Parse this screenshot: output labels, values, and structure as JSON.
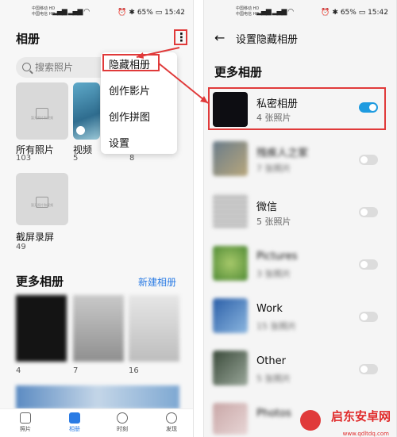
{
  "left": {
    "status": {
      "carrier_line1": "中国移动 HD",
      "carrier_line2": "中国电信 HD",
      "signal": "4G 4G",
      "battery": "65%",
      "time": "15:42"
    },
    "title": "相册",
    "search_placeholder": "搜索照片",
    "albums": [
      {
        "name": "所有照片",
        "count": "103"
      },
      {
        "name": "视频",
        "count": "5"
      },
      {
        "name": "",
        "count": "8"
      },
      {
        "name": "截屏录屏",
        "count": "49"
      }
    ],
    "thumb_caption": "暂无照片和视频",
    "menu": [
      "隐藏相册",
      "创作影片",
      "创作拼图",
      "设置"
    ],
    "more_albums_title": "更多相册",
    "new_album_link": "新建相册",
    "more_counts": [
      "4",
      "7",
      "16"
    ],
    "tabs": [
      {
        "label": "照片",
        "icon": "photo-icon"
      },
      {
        "label": "相册",
        "icon": "album-icon"
      },
      {
        "label": "时刻",
        "icon": "moment-icon"
      },
      {
        "label": "发现",
        "icon": "discover-icon"
      }
    ]
  },
  "right": {
    "status": {
      "carrier_line1": "中国移动 HD",
      "carrier_line2": "中国电信 HD",
      "signal": "4G 4G",
      "battery": "65%",
      "time": "15:42"
    },
    "title": "设置隐藏相册",
    "section": "更多相册",
    "albums": [
      {
        "name": "私密相册",
        "count": "4 张照片",
        "on": true
      },
      {
        "name": "残疾人之家",
        "count": "7 张照片",
        "on": false
      },
      {
        "name": "微信",
        "count": "5 张照片",
        "on": false
      },
      {
        "name": "Pictures",
        "count": "3 张照片",
        "on": false
      },
      {
        "name": "Work",
        "count": "15 张照片",
        "on": false
      },
      {
        "name": "Other",
        "count": "5 张照片",
        "on": false
      },
      {
        "name": "Photos",
        "count": "",
        "on": false
      }
    ]
  },
  "watermark": {
    "text": "启东安卓网",
    "url": "www.qdltdq.com"
  },
  "colors": {
    "accent": "#2a7be4",
    "highlight": "#e03a3a",
    "toggle_on": "#1e9be0"
  }
}
